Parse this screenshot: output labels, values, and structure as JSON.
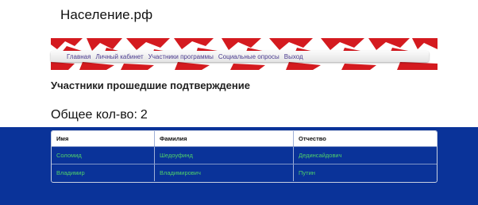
{
  "site": {
    "title": "Население.рф"
  },
  "nav": {
    "items": [
      "Главная",
      "Личный кабинет",
      "Участники программы",
      "Социальные опросы",
      "Выход"
    ]
  },
  "page": {
    "heading": "Участники прошедшие подтверждение",
    "total_label": "Общее кол-во:",
    "total_value": "2"
  },
  "table": {
    "columns": [
      "Имя",
      "Фамилия",
      "Отчество"
    ],
    "rows": [
      [
        "Соломид",
        "Шедоуфинд",
        "Дединсайдович"
      ],
      [
        "Владимир",
        "Владимирович",
        "Путин"
      ]
    ]
  },
  "colors": {
    "accent_blue": "#0a3399",
    "banner_red": "#d41a1f",
    "nav_link": "#4a3b8f",
    "cell_text": "#4fd06a"
  }
}
